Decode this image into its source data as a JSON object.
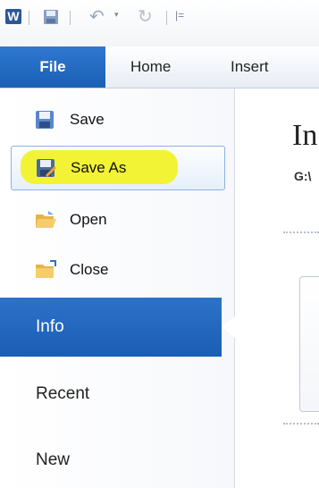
{
  "qat": {
    "logo_letter": "W",
    "separator_glyph": "|",
    "undo_glyph": "↶",
    "dropdown_glyph": "▾",
    "redo_glyph": "↻",
    "customize_glyph": "|="
  },
  "ribbon": {
    "tabs": [
      {
        "label": "File"
      },
      {
        "label": "Home"
      },
      {
        "label": "Insert"
      }
    ],
    "accent_color": "#1f63bb"
  },
  "backstage": {
    "commands": [
      {
        "label": "Save",
        "icon": "save-icon"
      },
      {
        "label": "Save As",
        "icon": "save-as-icon",
        "highlighted": true
      },
      {
        "label": "Open",
        "icon": "open-folder-icon"
      },
      {
        "label": "Close",
        "icon": "close-folder-icon"
      }
    ],
    "nav": [
      {
        "label": "Info",
        "selected": true
      },
      {
        "label": "Recent"
      },
      {
        "label": "New"
      }
    ],
    "highlight_color": "#f2f22a"
  },
  "info_pane": {
    "title": "In",
    "path": "G:\\"
  }
}
